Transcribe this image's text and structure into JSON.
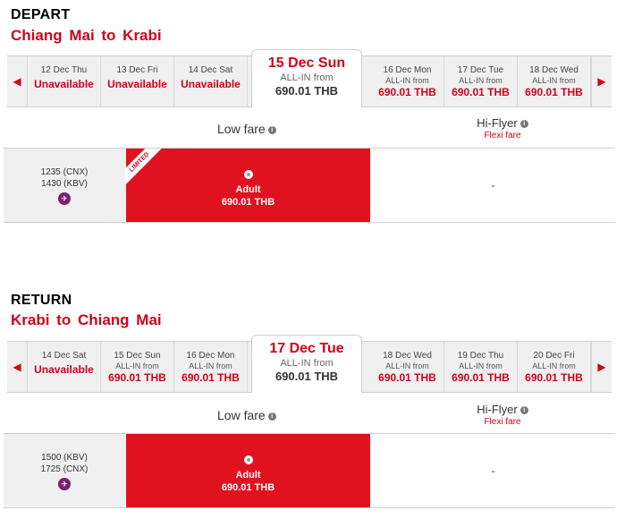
{
  "depart": {
    "title": "DEPART",
    "route": "Chiang Mai  to  Krabi",
    "dates": [
      {
        "date": "12 Dec Thu",
        "status": "Unavailable"
      },
      {
        "date": "13 Dec Fri",
        "status": "Unavailable"
      },
      {
        "date": "14 Dec Sat",
        "status": "Unavailable"
      },
      {
        "date": "15 Dec Sun",
        "sub": "ALL-IN from",
        "price": "690.01 THB"
      },
      {
        "date": "16 Dec Mon",
        "sub": "ALL-IN from",
        "price": "690.01 THB"
      },
      {
        "date": "17 Dec Tue",
        "sub": "ALL-IN from",
        "price": "690.01 THB"
      },
      {
        "date": "18 Dec Wed",
        "sub": "ALL-IN from",
        "price": "690.01 THB"
      }
    ],
    "fare_header": {
      "low": "Low fare",
      "hi": "Hi-Flyer",
      "hi_sub": "Flexi fare"
    },
    "flight": {
      "dep": "1235  (CNX)",
      "arr": "1430  (KBV)",
      "ribbon": "LIMITED",
      "fare_label": "Adult",
      "fare_price": "690.01 THB",
      "hi_value": "-"
    }
  },
  "return": {
    "title": "RETURN",
    "route": "Krabi  to  Chiang Mai",
    "dates": [
      {
        "date": "14 Dec Sat",
        "status": "Unavailable"
      },
      {
        "date": "15 Dec Sun",
        "sub": "ALL-IN from",
        "price": "690.01 THB"
      },
      {
        "date": "16 Dec Mon",
        "sub": "ALL-IN from",
        "price": "690.01 THB"
      },
      {
        "date": "17 Dec Tue",
        "sub": "ALL-IN from",
        "price": "690.01 THB"
      },
      {
        "date": "18 Dec Wed",
        "sub": "ALL-IN from",
        "price": "690.01 THB"
      },
      {
        "date": "19 Dec Thu",
        "sub": "ALL-IN from",
        "price": "690.01 THB"
      },
      {
        "date": "20 Dec Fri",
        "sub": "ALL-IN from",
        "price": "690.01 THB"
      }
    ],
    "fare_header": {
      "low": "Low fare",
      "hi": "Hi-Flyer",
      "hi_sub": "Flexi fare"
    },
    "flight": {
      "dep": "1500  (KBV)",
      "arr": "1725  (CNX)",
      "fare_label": "Adult",
      "fare_price": "690.01 THB",
      "hi_value": "-"
    }
  },
  "icons": {
    "info": "i",
    "prev": "◀",
    "next": "▶",
    "plane": "✈"
  },
  "colors": {
    "accent": "#d0021b",
    "fare_bg": "#e0121f",
    "plane_badge": "#7b1f6e"
  }
}
